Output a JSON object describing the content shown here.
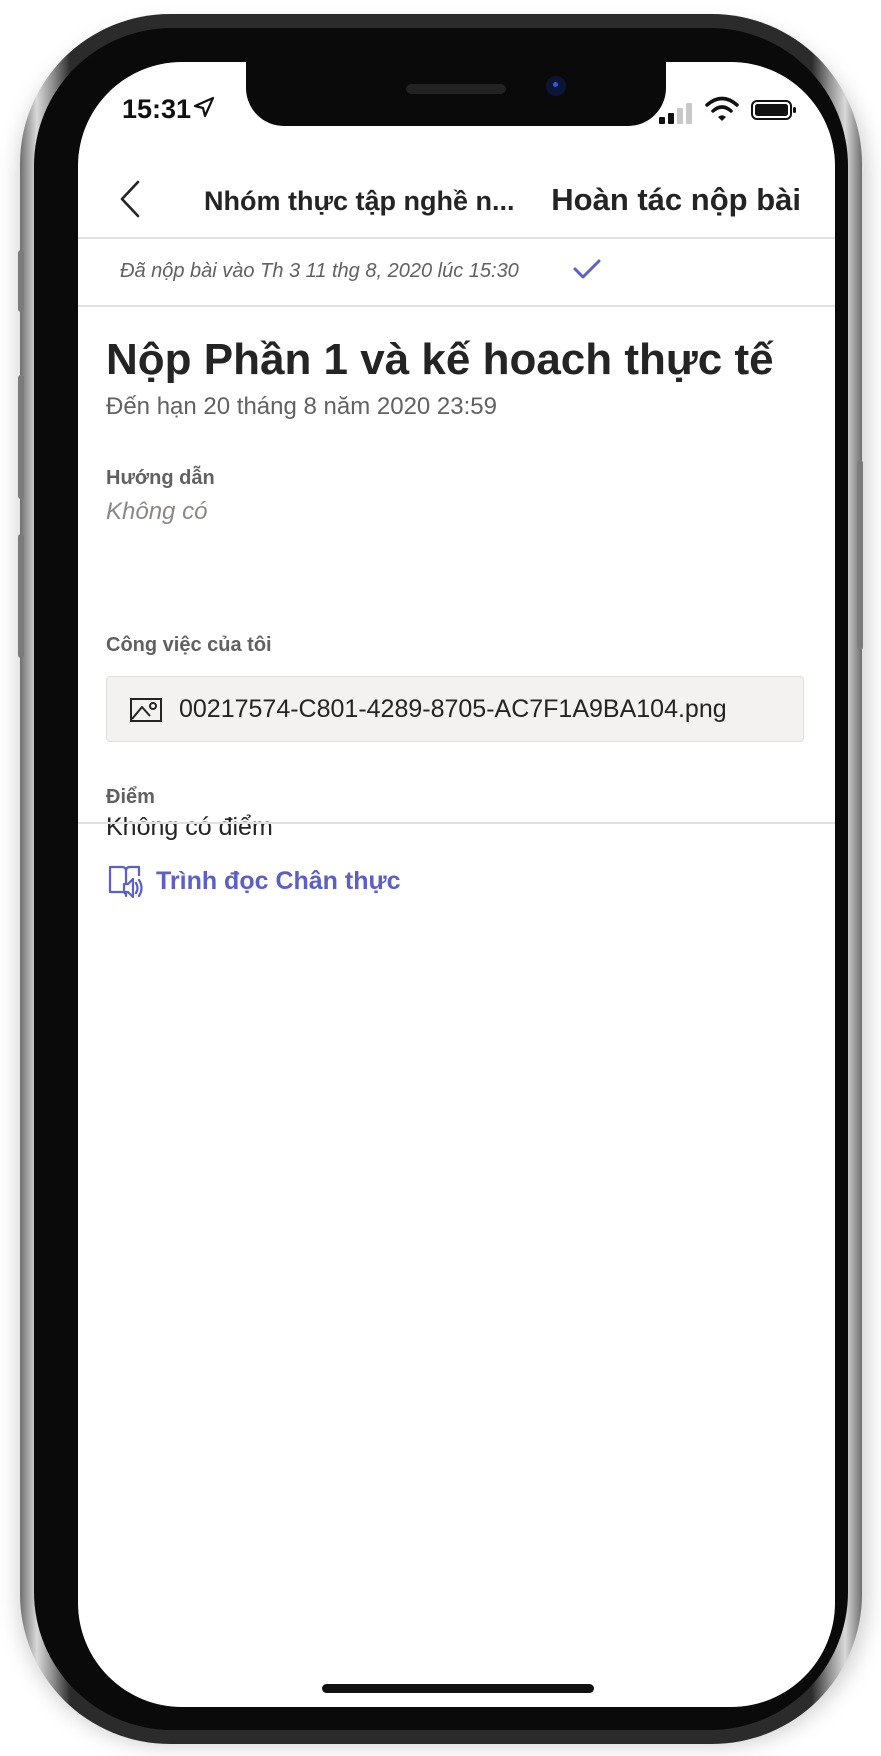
{
  "status_bar": {
    "time": "15:31",
    "location_icon": "location-arrow-icon",
    "signal_icon": "cellular-signal-icon",
    "wifi_icon": "wifi-icon",
    "battery_icon": "battery-icon"
  },
  "header": {
    "back_icon": "chevron-left-icon",
    "title": "Nhóm thực tập nghề n...",
    "action_label": "Hoàn tác nộp bài"
  },
  "submission_status": {
    "text": "Đã nộp bài vào Th 3 11 thg 8, 2020 lúc 15:30",
    "icon": "checkmark-icon"
  },
  "assignment": {
    "title": "Nộp Phần 1 và kế hoach thực tế",
    "due": "Đến hạn 20 tháng 8 năm 2020 23:59",
    "instructions_label": "Hướng dẫn",
    "instructions_value": "Không có",
    "my_work_label": "Công việc của tôi",
    "attachment": {
      "icon": "image-file-icon",
      "file_name": "00217574-C801-4289-8705-AC7F1A9BA104.png"
    },
    "points_label": "Điểm",
    "points_value": "Không có điểm"
  },
  "immersive_reader": {
    "icon": "immersive-reader-icon",
    "label": "Trình đọc Chân thực"
  },
  "colors": {
    "accent": "#5b5fc7",
    "text_primary": "#252424",
    "text_secondary": "#616161",
    "divider": "#e1e1e1",
    "file_box_bg": "#f3f2f1"
  }
}
